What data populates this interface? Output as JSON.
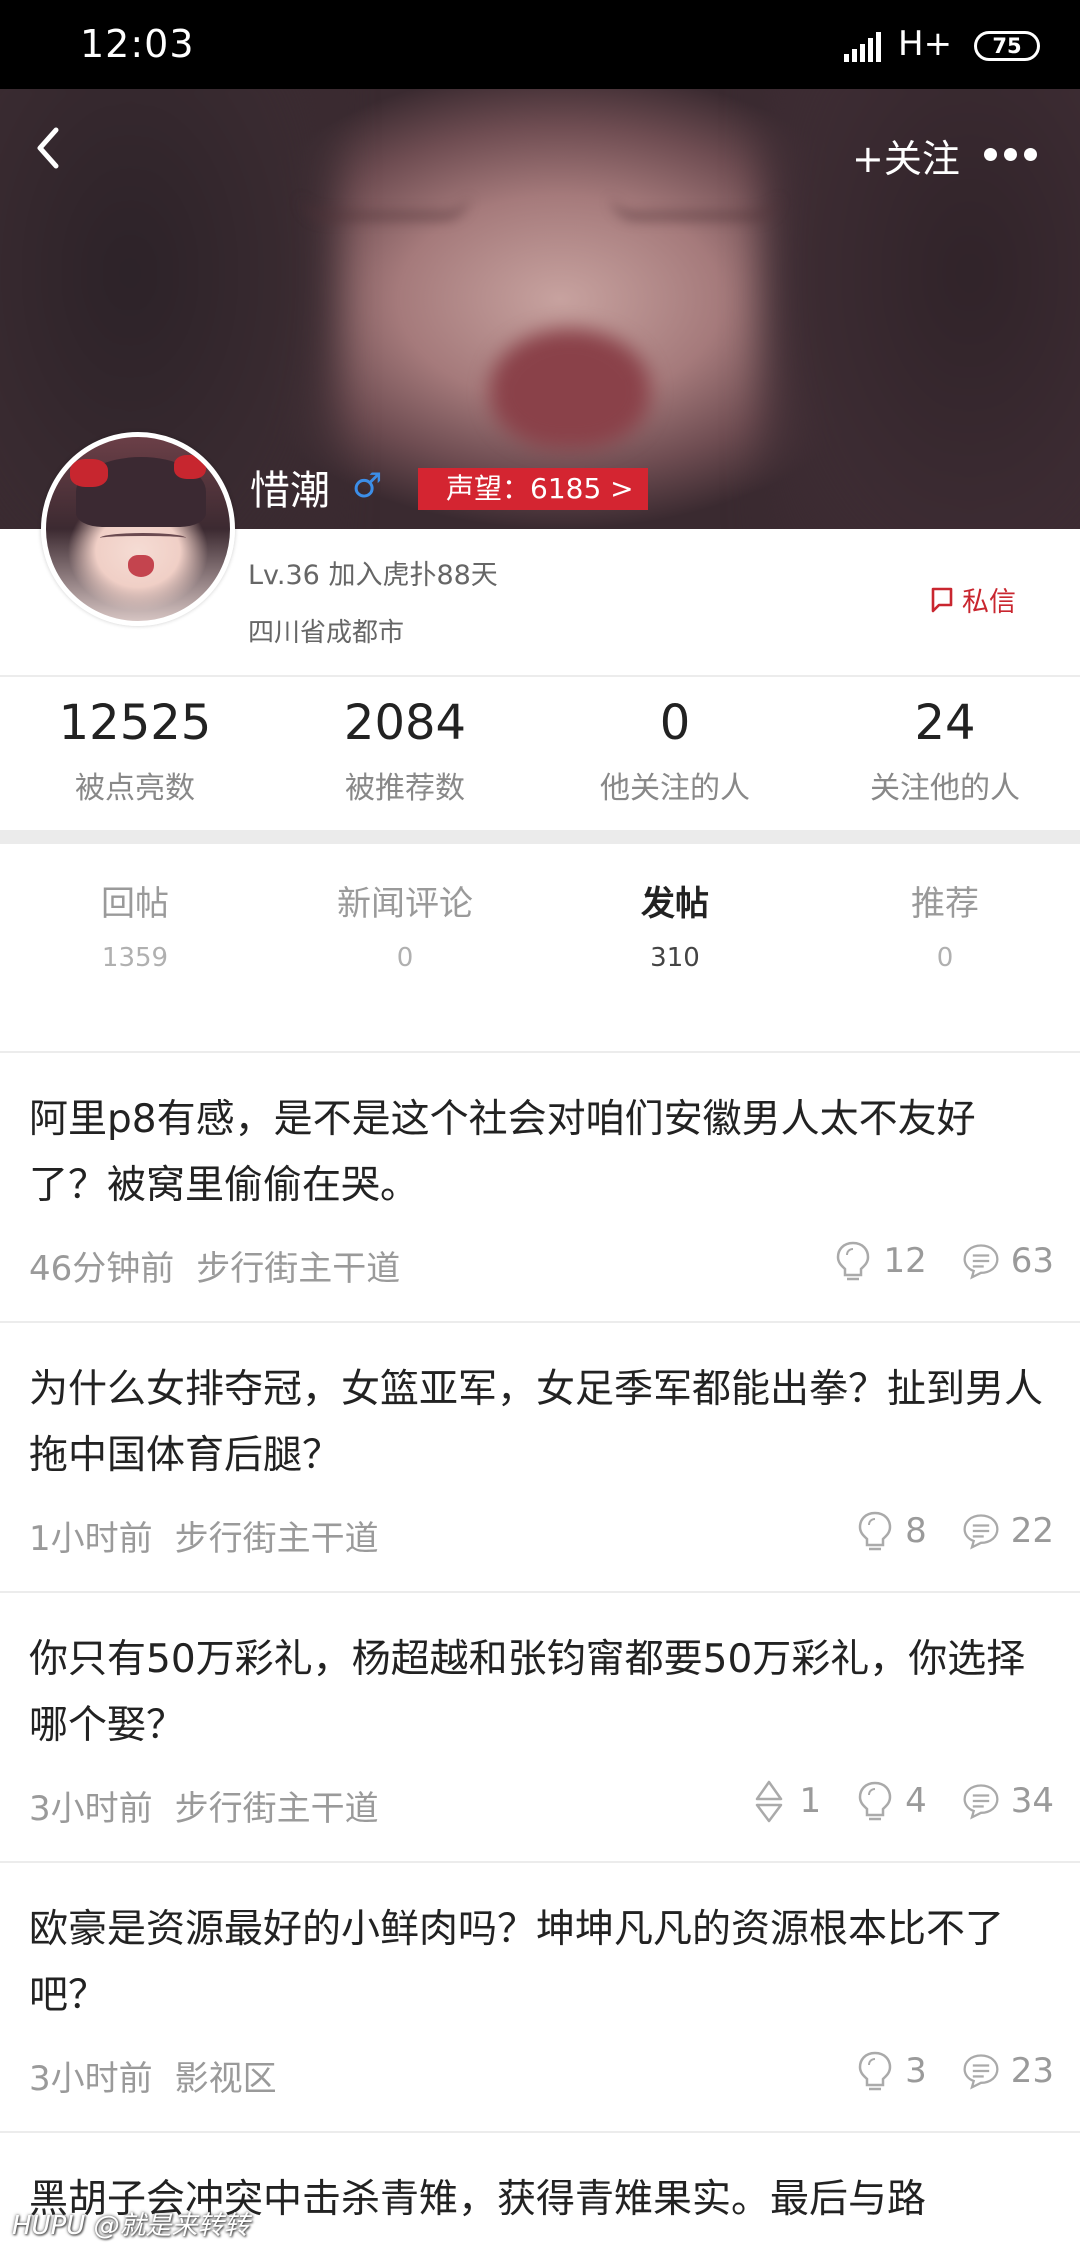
{
  "status_bar": {
    "time": "12:03",
    "network": "H+",
    "battery": "75"
  },
  "header": {
    "follow_label": "+关注"
  },
  "profile": {
    "username": "惜潮",
    "gender_symbol": "♂",
    "reputation": "声望：6185 >",
    "level_join": "Lv.36  加入虎扑88天",
    "location": "四川省成都市",
    "message_label": "私信"
  },
  "stats": [
    {
      "value": "12525",
      "label": "被点亮数"
    },
    {
      "value": "2084",
      "label": "被推荐数"
    },
    {
      "value": "0",
      "label": "他关注的人"
    },
    {
      "value": "24",
      "label": "关注他的人"
    }
  ],
  "tabs": [
    {
      "label": "回帖",
      "count": "1359"
    },
    {
      "label": "新闻评论",
      "count": "0"
    },
    {
      "label": "发帖",
      "count": "310"
    },
    {
      "label": "推荐",
      "count": "0"
    }
  ],
  "active_tab": "发帖",
  "posts": [
    {
      "title": "阿里p8有感，是不是这个社会对咱们安徽男人太不友好了？被窝里偷偷在哭。",
      "time": "46分钟前",
      "forum": "步行街主干道",
      "lights": "12",
      "replies": "63"
    },
    {
      "title": "为什么女排夺冠，女篮亚军，女足季军都能出拳？扯到男人拖中国体育后腿？",
      "time": "1小时前",
      "forum": "步行街主干道",
      "lights": "8",
      "replies": "22"
    },
    {
      "title": "你只有50万彩礼，杨超越和张钧甯都要50万彩礼，你选择哪个娶？",
      "time": "3小时前",
      "forum": "步行街主干道",
      "recommends": "1",
      "lights": "4",
      "replies": "34"
    },
    {
      "title": "欧豪是资源最好的小鲜肉吗？坤坤凡凡的资源根本比不了吧？",
      "time": "3小时前",
      "forum": "影视区",
      "lights": "3",
      "replies": "23"
    },
    {
      "title": "黑胡子会冲突中击杀青雉，获得青雉果实。最后与路",
      "time": "",
      "forum": ""
    }
  ],
  "watermark": "HUPU @就是来转转",
  "colors": {
    "accent_red": "#d42531",
    "male_blue": "#3c8ee8",
    "text_gray": "#9a9a9a"
  }
}
